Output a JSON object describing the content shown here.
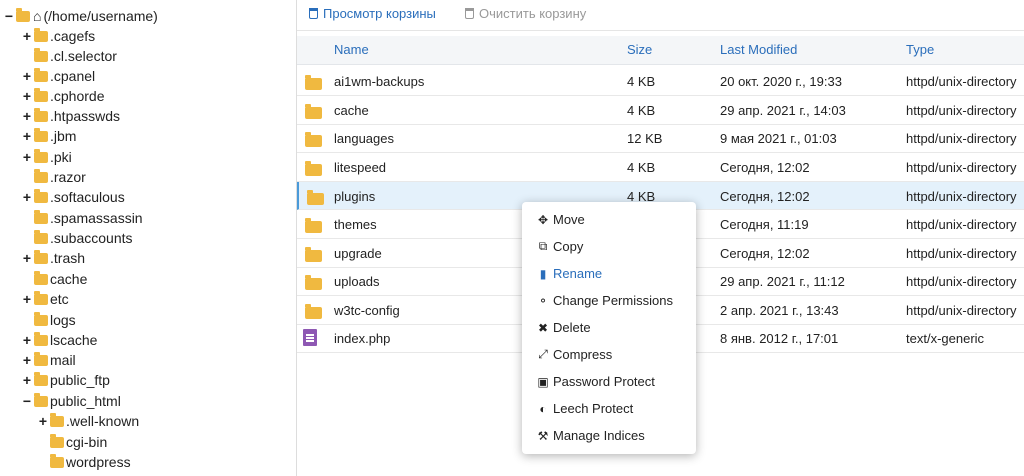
{
  "sidebar": {
    "root": "(/home/username)",
    "items": [
      {
        "toggle": "+",
        "label": ".cagefs"
      },
      {
        "toggle": "",
        "label": ".cl.selector"
      },
      {
        "toggle": "+",
        "label": ".cpanel"
      },
      {
        "toggle": "+",
        "label": ".cphorde"
      },
      {
        "toggle": "+",
        "label": ".htpasswds"
      },
      {
        "toggle": "+",
        "label": ".jbm"
      },
      {
        "toggle": "+",
        "label": ".pki"
      },
      {
        "toggle": "",
        "label": ".razor"
      },
      {
        "toggle": "+",
        "label": ".softaculous"
      },
      {
        "toggle": "",
        "label": ".spamassassin"
      },
      {
        "toggle": "",
        "label": ".subaccounts"
      },
      {
        "toggle": "+",
        "label": ".trash"
      },
      {
        "toggle": "",
        "label": "cache"
      },
      {
        "toggle": "+",
        "label": "etc"
      },
      {
        "toggle": "",
        "label": "logs"
      },
      {
        "toggle": "+",
        "label": "lscache"
      },
      {
        "toggle": "+",
        "label": "mail"
      },
      {
        "toggle": "+",
        "label": "public_ftp"
      },
      {
        "toggle": "−",
        "label": "public_html"
      },
      {
        "toggle": "+",
        "label": ".well-known"
      },
      {
        "toggle": "",
        "label": "cgi-bin"
      },
      {
        "toggle": "",
        "label": "wordpress"
      }
    ]
  },
  "toolbar": {
    "view_trash": "Просмотр корзины",
    "empty_trash": "Очистить корзину"
  },
  "table": {
    "headers": {
      "name": "Name",
      "size": "Size",
      "modified": "Last Modified",
      "type": "Type"
    },
    "rows": [
      {
        "name": "ai1wm-backups",
        "size": "4 KB",
        "modified": "20 окт. 2020 г., 19:33",
        "type": "httpd/unix-directory",
        "icon": "folder-icon"
      },
      {
        "name": "cache",
        "size": "4 KB",
        "modified": "29 апр. 2021 г., 14:03",
        "type": "httpd/unix-directory",
        "icon": "folder-icon"
      },
      {
        "name": "languages",
        "size": "12 KB",
        "modified": "9 мая 2021 г., 01:03",
        "type": "httpd/unix-directory",
        "icon": "folder-icon"
      },
      {
        "name": "litespeed",
        "size": "4 KB",
        "modified": "Сегодня, 12:02",
        "type": "httpd/unix-directory",
        "icon": "folder-icon"
      },
      {
        "name": "plugins",
        "size": "4 KB",
        "modified": "Сегодня, 12:02",
        "type": "httpd/unix-directory",
        "icon": "folder-icon"
      },
      {
        "name": "themes",
        "size": "",
        "modified": "Сегодня, 11:19",
        "type": "httpd/unix-directory",
        "icon": "folder-icon"
      },
      {
        "name": "upgrade",
        "size": "",
        "modified": "Сегодня, 12:02",
        "type": "httpd/unix-directory",
        "icon": "folder-icon"
      },
      {
        "name": "uploads",
        "size": "",
        "modified": "29 апр. 2021 г., 11:12",
        "type": "httpd/unix-directory",
        "icon": "folder-icon"
      },
      {
        "name": "w3tc-config",
        "size": "",
        "modified": "2 апр. 2021 г., 13:43",
        "type": "httpd/unix-directory",
        "icon": "folder-icon"
      },
      {
        "name": "index.php",
        "size": "",
        "modified": "8 янв. 2012 г., 17:01",
        "type": "text/x-generic",
        "icon": "file-icon"
      }
    ]
  },
  "context_menu": {
    "items": [
      {
        "label": "Move",
        "icon": "move-icon"
      },
      {
        "label": "Copy",
        "icon": "copy-icon"
      },
      {
        "label": "Rename",
        "icon": "rename-icon"
      },
      {
        "label": "Change Permissions",
        "icon": "key-icon"
      },
      {
        "label": "Delete",
        "icon": "delete-icon"
      },
      {
        "label": "Compress",
        "icon": "compress-icon"
      },
      {
        "label": "Password Protect",
        "icon": "lock-icon"
      },
      {
        "label": "Leech Protect",
        "icon": "shield-icon"
      },
      {
        "label": "Manage Indices",
        "icon": "wrench-icon"
      }
    ]
  },
  "colors": {
    "link": "#2a6ebb",
    "folder": "#f0b940",
    "selected_row": "#e4f1fb",
    "file_php": "#8e58b3"
  }
}
